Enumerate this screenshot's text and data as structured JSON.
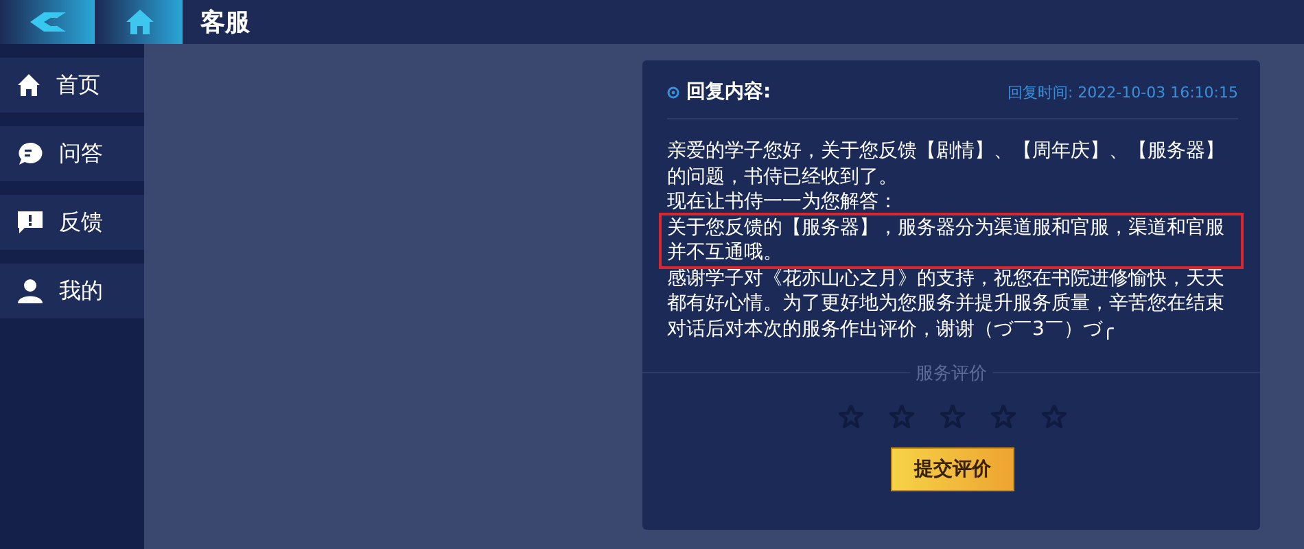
{
  "header": {
    "title": "客服"
  },
  "sidebar": {
    "items": [
      {
        "label": "首页"
      },
      {
        "label": "问答"
      },
      {
        "label": "反馈"
      },
      {
        "label": "我的"
      }
    ]
  },
  "reply": {
    "title": "回复内容:",
    "time": "回复时间: 2022-10-03 16:10:15",
    "paragraphs": [
      {
        "text": "亲爱的学子您好，关于您反馈【剧情】、【周年庆】、【服务器】的问题，书侍已经收到了。",
        "highlighted": false
      },
      {
        "text": "现在让书侍一一为您解答：",
        "highlighted": false
      },
      {
        "text": "关于您反馈的【服务器】，服务器分为渠道服和官服，渠道和官服并不互通哦。",
        "highlighted": true
      },
      {
        "text": "感谢学子对《花亦山心之月》的支持，祝您在书院进修愉快，天天都有好心情。为了更好地为您服务并提升服务质量，辛苦您在结束对话后对本次的服务作出评价，谢谢（づ￣3￣）づ╭",
        "highlighted": false
      }
    ]
  },
  "rating": {
    "label": "服务评价",
    "stars": 0
  },
  "submit_button": "提交评价"
}
